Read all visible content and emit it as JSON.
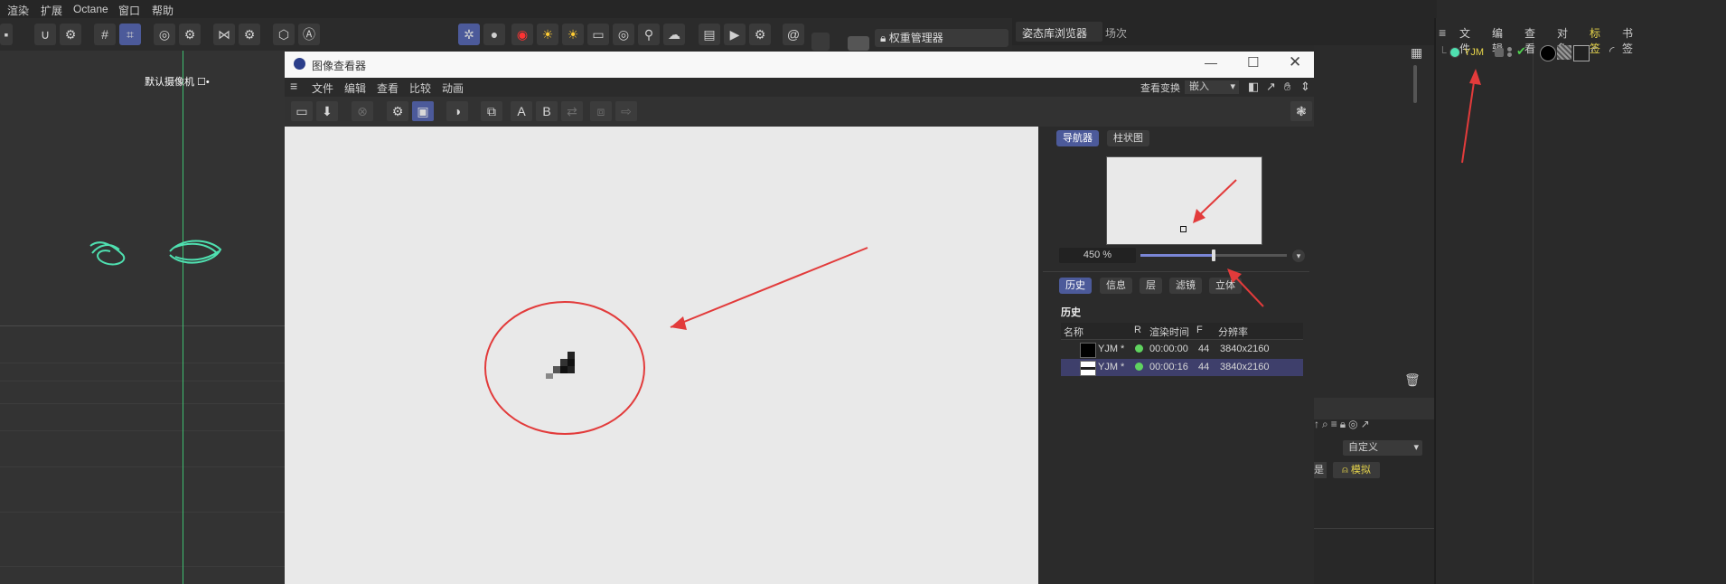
{
  "app_menu": [
    "渲染",
    "扩展",
    "Octane",
    "窗口",
    "帮助"
  ],
  "viewport": {
    "camera_label": "默认摄像机 ☐•"
  },
  "toolbar_icons": [
    "magnet-icon",
    "settings-icon",
    "grid-icon",
    "snap-icon",
    "circle-icon",
    "gear-icon",
    "butterfly-icon",
    "gear-icon",
    "cube-icon",
    "a-icon"
  ],
  "octane_icons": [
    "octane-icon",
    "sphere-icon",
    "camera-render-icon",
    "sun-icon",
    "sun-icon",
    "light-icon",
    "target-icon",
    "spot-icon",
    "bulb-icon"
  ],
  "render_icons": [
    "clapper-icon",
    "clapper-play-icon",
    "clapper-settings-icon",
    "spiral-icon"
  ],
  "weight_manager": "权重管理器",
  "content_browser": {
    "tabs": [
      "姿态库浏览器",
      "场次"
    ]
  },
  "object_panel": {
    "menu": [
      "文件",
      "编辑",
      "查看",
      "对象",
      "标签",
      "书签"
    ],
    "item_name": "YJM",
    "accent": "#e6d44a"
  },
  "image_viewer": {
    "title": "图像查看器",
    "menu": [
      "文件",
      "编辑",
      "查看",
      "比较",
      "动画"
    ],
    "view_transform_label": "查看变换",
    "view_transform_value": "嵌入",
    "tabs_top": [
      "导航器",
      "柱状图"
    ],
    "zoom": "450 %",
    "zoom_slider_fraction": 0.5,
    "tabs_bottom": [
      "历史",
      "信息",
      "层",
      "滤镜",
      "立体"
    ],
    "history_title": "历史",
    "history_columns": [
      "名称",
      "R",
      "渲染时间",
      "F",
      "分辨率"
    ],
    "history_rows": [
      {
        "name": "YJM *",
        "time": "00:00:00",
        "f": "44",
        "res": "3840x2160"
      },
      {
        "name": "YJM *",
        "time": "00:00:16",
        "f": "44",
        "res": "3840x2160"
      }
    ]
  },
  "lower_panel": {
    "dropdown": "自定义",
    "button": "模拟"
  },
  "colors": {
    "accent": "#4c5a9a",
    "annotation": "#e23b3b",
    "spline": "#4fe0b0"
  }
}
